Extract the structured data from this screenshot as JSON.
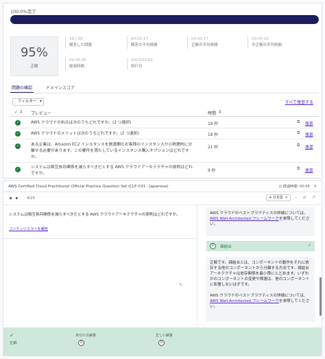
{
  "progress": {
    "label": "100.0%完了",
    "percent": 100
  },
  "score": {
    "value": "95%",
    "label": "正解"
  },
  "stats": [
    {
      "value": "39 / 39",
      "label": "解答した問題"
    },
    {
      "value": "00:00:17",
      "label": "解答の平均時間"
    },
    {
      "value": "00:00:17",
      "label": "正解の平均時間"
    },
    {
      "value": "00:00:15",
      "label": "不正解の平均時間"
    },
    {
      "value": "00:05:35",
      "label": "経過時間"
    },
    {
      "value": "2023/02/02",
      "label": "試行日"
    }
  ],
  "tabs": [
    {
      "label": "問題の確認"
    },
    {
      "label": "ドメインスコア"
    }
  ],
  "filter": {
    "label": "フィルター",
    "chevron": "▾"
  },
  "review_all": "すべて復習する",
  "table": {
    "headers": {
      "check": "✓",
      "check_sort": "⇕",
      "preview": "プレビュー",
      "time": "時間",
      "time_sort": "⇕"
    },
    "rows": [
      {
        "question": "AWS クラウドの利点は次のうちどれですか。(2 つ選択)",
        "time": "18 秒",
        "review": "復習"
      },
      {
        "question": "AWS クラウドのメリットは次のうちどれですか。(2 つ選択)",
        "time": "18 秒",
        "review": "復習"
      },
      {
        "question": "ある企業は、Amazon EC2 インスタンスを数週間のお客様のインスタンスから物理的に分離する必要があります。この要件を満たしているインスタンス購入オプションはどれですか。",
        "time": "21 秒",
        "review": "復習"
      },
      {
        "question": "システムは相互依存関係を減らすべきだとする AWS クラウドアーキテクチャの原則はどれですか。",
        "time": "9 秒",
        "review": "復習"
      }
    ]
  },
  "panel": {
    "title": "AWS Certified Cloud Practitioner Official Practice Question Set (CLF-C01 - Japanese)",
    "timer": "経過時間: 00:05",
    "nav_prev": "◀",
    "nav_next": "▶",
    "page": "4/20",
    "language": "日本語",
    "question": "システムは相互依存関係を減らすべきだとする AWS クラウドアーキテクチャの原則はどれですか。",
    "report": "コンテンツエラーを報告",
    "explanation_top": {
      "text": "AWS クラウドのベストプラクティスの詳細については、",
      "link": "AWS Well-Architected フレームワーク",
      "suffix": "を参照してください。"
    },
    "correct_header": {
      "letter": "D",
      "label": "疎結合",
      "mark": "✓"
    },
    "explanation": "正解です。疎結合とは、コンポーネントの動作をそれに依存する他のコンポーネントから分離する方法です。疎結合アーキテクチャは依存関係を最小限にとどめます。いずれかのコンポーネントの変更や障害は、他のコンポーネントに影響しないはずです。",
    "explanation_ref": {
      "text": "AWS クラウドのベストプラクティスの詳細については、",
      "link": "AWS Well-Architected フレームワーク",
      "suffix": "を参照してください。"
    }
  },
  "result": {
    "mark": "✓",
    "label": "正解",
    "your_answer_label": "あなたの解答",
    "your_answer": "D",
    "correct_answer_label": "正しい解答",
    "correct_answer": "D"
  },
  "icons": {
    "check": "check-circle-icon",
    "external": "external-link-icon",
    "clock": "clock-icon",
    "globe": "globe-icon"
  }
}
